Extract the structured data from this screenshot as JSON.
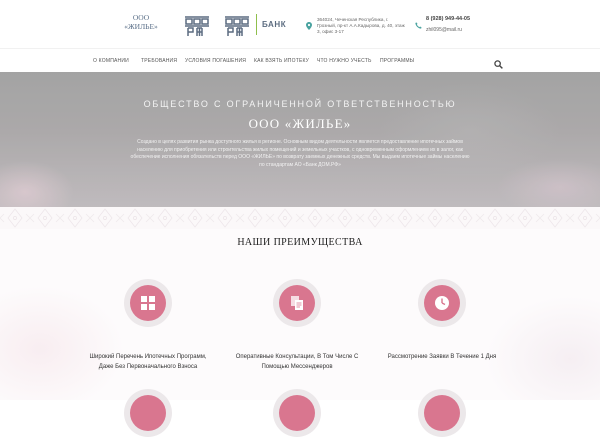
{
  "header": {
    "brand_line1": "ООО",
    "brand_line2": "«ЖИЛЬЕ»",
    "logo1_text": "ДОМ РФ",
    "logo2_text": "ДОМ РФ",
    "bank_label": "БАНК",
    "address": "364024, Чеченская Республика, г. Грозный, пр-кт А.А.Кадырова, д. 40, этаж 3, офис 3-17",
    "phone": "8 (928) 949-44-05",
    "email": "zhil095@mail.ru",
    "colors": {
      "logo": "#5c6c80",
      "accent_green": "#8fbf4c",
      "icon_teal": "#4aa3a0"
    }
  },
  "nav": {
    "items": [
      {
        "label": "О компании"
      },
      {
        "label": "Требования"
      },
      {
        "label": "Условия погашения"
      },
      {
        "label": "Как взять ипотеку"
      },
      {
        "label": "Что нужно учесть"
      },
      {
        "label": "Программы"
      }
    ],
    "search_icon": "search-icon"
  },
  "hero": {
    "subtitle": "ОБЩЕСТВО С ОГРАНИЧЕННОЙ ОТВЕТСТВЕННОСТЬЮ",
    "title": "ООО «ЖИЛЬЕ»",
    "description": "Создано в целях развития рынка доступного жилья в регионе. Основным видом деятельности является предоставление ипотечных займов населению для приобретения или строительства жилых помещений и земельных участков, с одновременным оформлением их в залог, как обеспечение исполнения обязательств перед ООО «ЖИЛЬЕ» по возврату заемных денежных средств. Мы выдаем ипотечные займы населению по стандартам АО «Банк ДОМ.РФ»"
  },
  "advantages": {
    "title": "НАШИ ПРЕИМУЩЕСТВА",
    "accent": "#d9768f",
    "items": [
      {
        "icon": "grid-icon",
        "label_line1": "Широкий Перечень Ипотечных Программ,",
        "label_line2": "Даже Без Первоначального Взноса"
      },
      {
        "icon": "documents-icon",
        "label_line1": "Оперативные Консультации, В Том Числе С",
        "label_line2": "Помощью Мессенджеров"
      },
      {
        "icon": "clock-icon",
        "label_line1": "Рассмотрение Заявки В Течение 1 Дня",
        "label_line2": ""
      }
    ]
  }
}
